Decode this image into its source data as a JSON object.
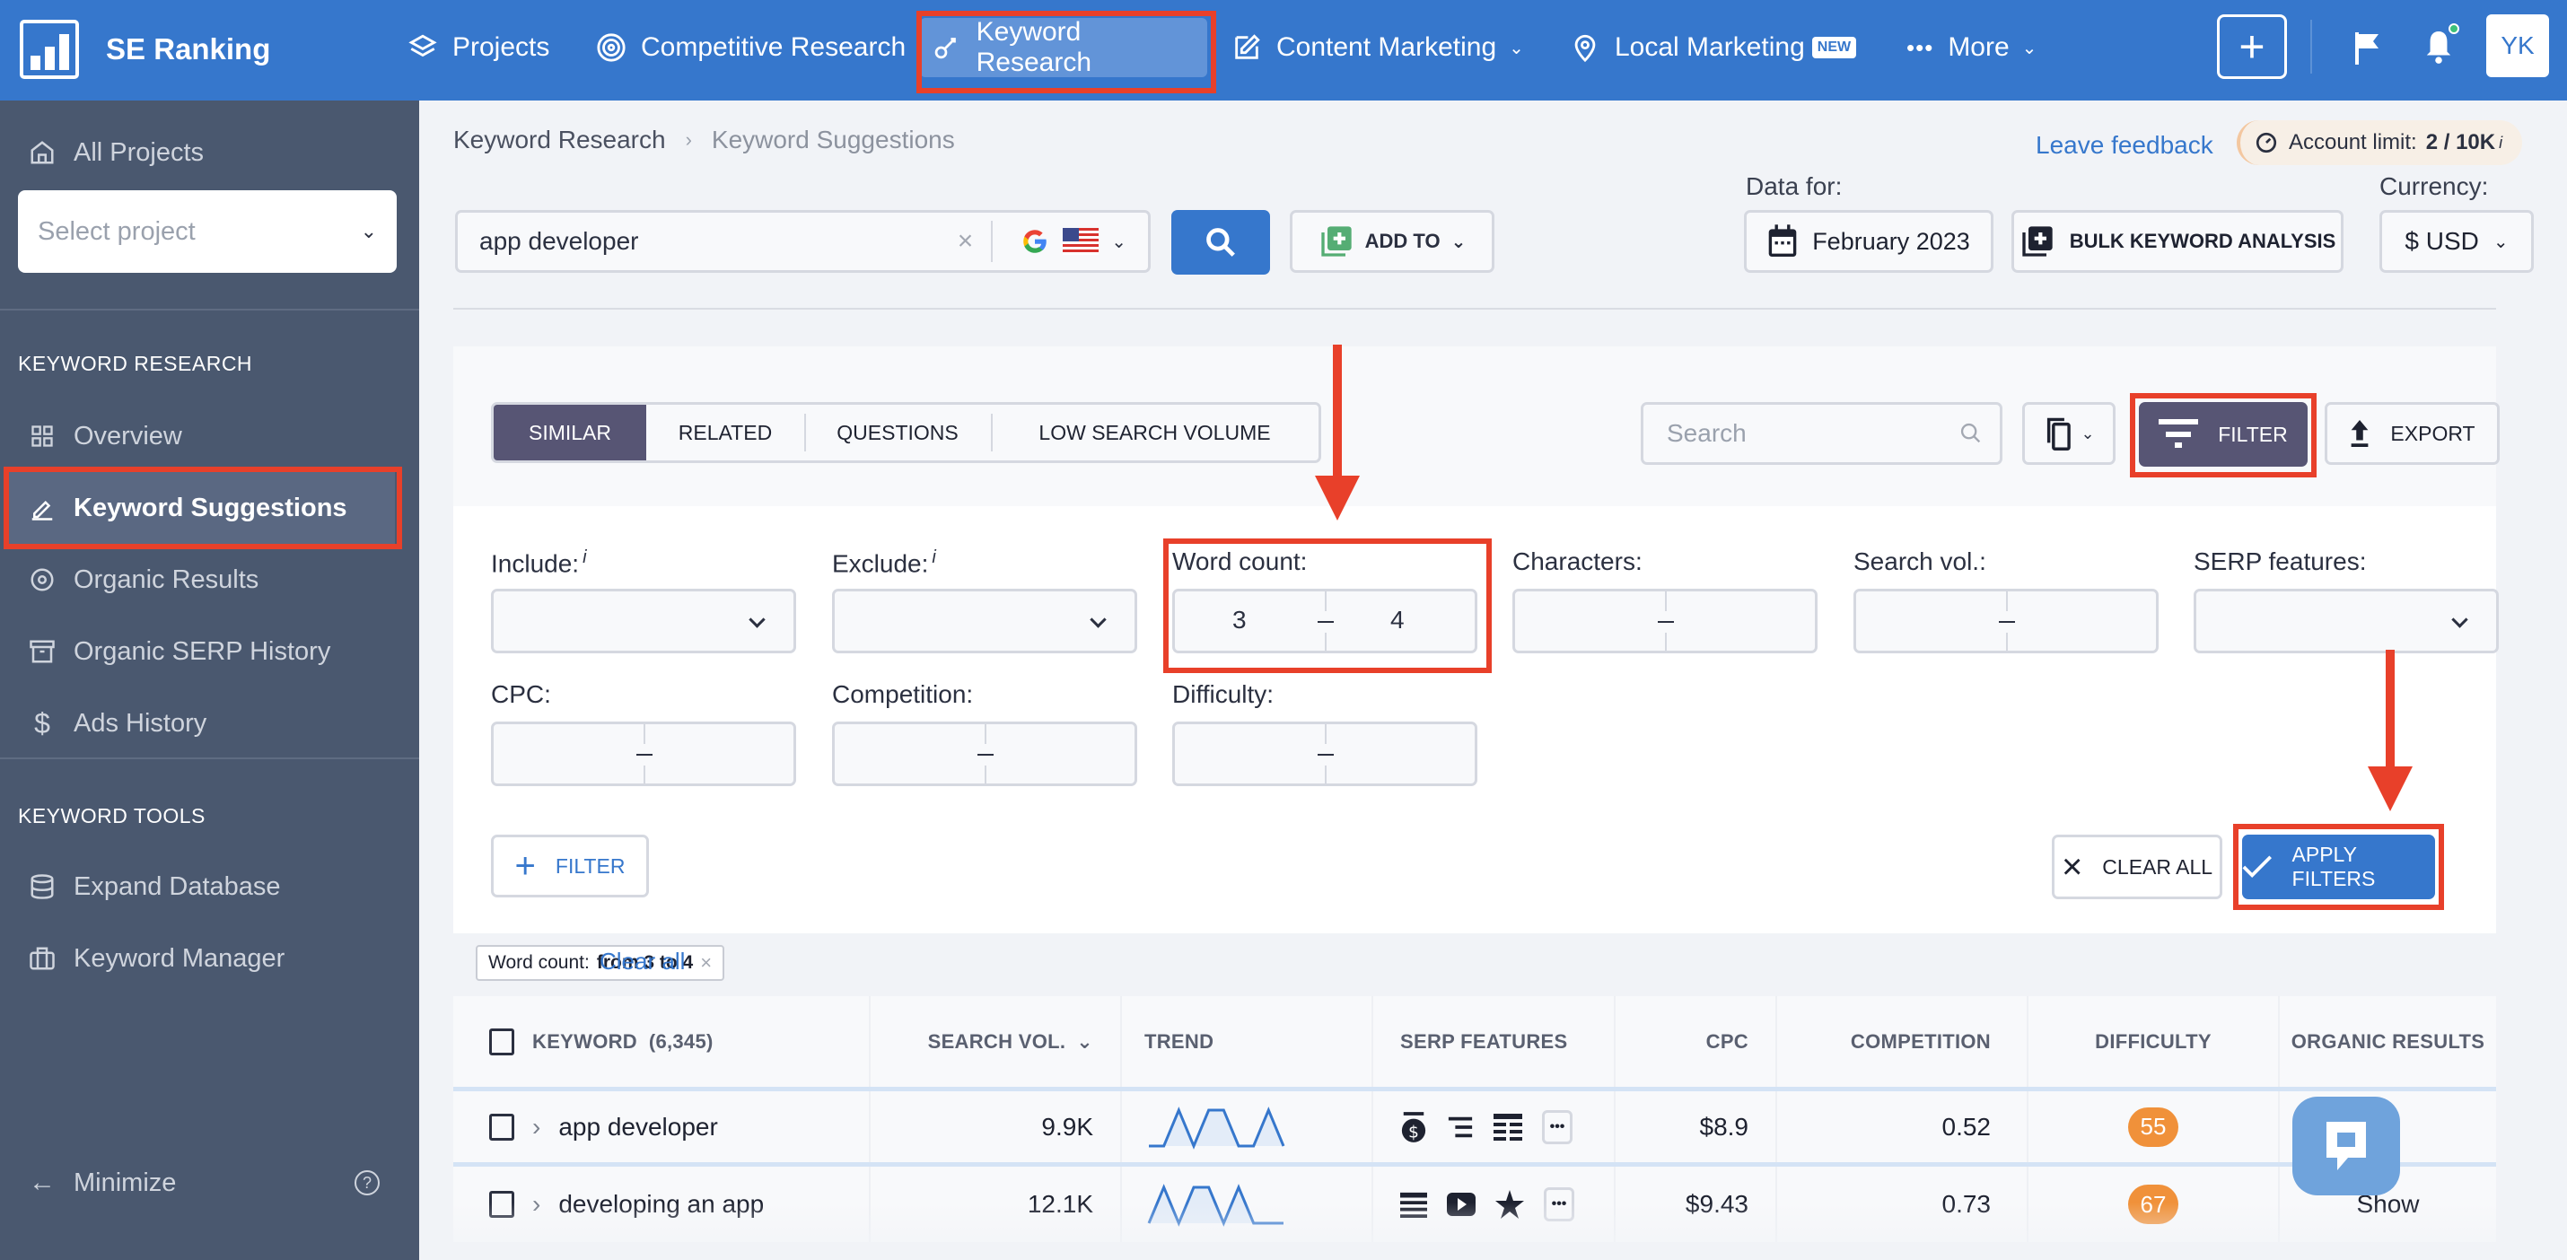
{
  "app": {
    "name": "SE Ranking",
    "user_initials": "YK"
  },
  "topnav": {
    "items": [
      {
        "label": "Projects",
        "icon": "layers-icon"
      },
      {
        "label": "Competitive Research",
        "icon": "target-icon"
      },
      {
        "label": "Keyword Research",
        "icon": "key-icon",
        "active": true
      },
      {
        "label": "Content Marketing",
        "icon": "edit-icon",
        "dropdown": true
      },
      {
        "label": "Local Marketing",
        "icon": "map-pin-icon",
        "badge": "NEW"
      },
      {
        "label": "More",
        "icon": "dots-icon",
        "dropdown": true
      }
    ]
  },
  "sidebar": {
    "all_projects": "All Projects",
    "select_project_placeholder": "Select project",
    "section_research": "KEYWORD RESEARCH",
    "research_items": [
      {
        "label": "Overview",
        "icon": "grid-icon"
      },
      {
        "label": "Keyword Suggestions",
        "icon": "pencil-icon",
        "active": true
      },
      {
        "label": "Organic Results",
        "icon": "eye-icon"
      },
      {
        "label": "Organic SERP History",
        "icon": "archive-icon"
      },
      {
        "label": "Ads History",
        "icon": "dollar-icon"
      }
    ],
    "section_tools": "KEYWORD TOOLS",
    "tool_items": [
      {
        "label": "Expand Database",
        "icon": "database-icon"
      },
      {
        "label": "Keyword Manager",
        "icon": "briefcase-icon"
      }
    ],
    "minimize": "Minimize"
  },
  "header": {
    "breadcrumb": [
      "Keyword Research",
      "Keyword Suggestions"
    ],
    "leave_feedback": "Leave feedback",
    "account_limit_label": "Account limit:",
    "account_limit_value": "2 / 10K",
    "info_mark": "i",
    "search_value": "app developer",
    "add_to": "ADD TO",
    "data_for_label": "Data for:",
    "date": "February 2023",
    "bulk": "BULK KEYWORD ANALYSIS",
    "currency_label": "Currency:",
    "currency": "$ USD"
  },
  "toolbar": {
    "tabs": [
      "SIMILAR",
      "RELATED",
      "QUESTIONS",
      "LOW SEARCH VOLUME"
    ],
    "active_tab": "SIMILAR",
    "search_placeholder": "Search",
    "filter": "FILTER",
    "export": "EXPORT"
  },
  "filters": {
    "include": {
      "label": "Include:",
      "info": "i"
    },
    "exclude": {
      "label": "Exclude:",
      "info": "i"
    },
    "word_count": {
      "label": "Word count:",
      "from": "3",
      "to": "4"
    },
    "characters": {
      "label": "Characters:"
    },
    "search_vol": {
      "label": "Search vol.:"
    },
    "serp_features": {
      "label": "SERP features:"
    },
    "cpc": {
      "label": "CPC:"
    },
    "competition": {
      "label": "Competition:"
    },
    "difficulty": {
      "label": "Difficulty:"
    },
    "add_filter": "FILTER",
    "clear_all": "CLEAR ALL",
    "apply": "APPLY FILTERS"
  },
  "active_filters": {
    "chip_label": "Word count:",
    "chip_value": "from 3 to 4",
    "clear_all": "Clear all"
  },
  "table": {
    "columns": {
      "keyword": "KEYWORD",
      "keyword_count": "(6,345)",
      "search_vol": "SEARCH VOL.",
      "trend": "TREND",
      "serp": "SERP FEATURES",
      "cpc": "CPC",
      "competition": "COMPETITION",
      "difficulty": "DIFFICULTY",
      "organic": "ORGANIC RESULTS"
    },
    "rows": [
      {
        "keyword": "app developer",
        "search_vol": "9.9K",
        "trend": [
          0,
          0,
          1,
          0,
          1,
          1,
          0,
          0,
          1,
          0
        ],
        "serp_icons": [
          "paid-ads-icon",
          "featured-snippet-icon",
          "table-icon"
        ],
        "cpc": "$8.9",
        "competition": "0.52",
        "difficulty": "55",
        "organic": ""
      },
      {
        "keyword": "developing an app",
        "search_vol": "12.1K",
        "trend": [
          0,
          1,
          0,
          1,
          1,
          0,
          1,
          0,
          0,
          0
        ],
        "serp_icons": [
          "list-icon",
          "video-icon",
          "reviews-star-icon"
        ],
        "cpc": "$9.43",
        "competition": "0.73",
        "difficulty": "67",
        "organic": "Show"
      }
    ]
  },
  "colors": {
    "brand_blue": "#3677cc",
    "sidebar_bg": "#4a586f",
    "tab_active": "#575574",
    "difficulty_orange": "#f0913a",
    "annotation_red": "#e8402a"
  }
}
